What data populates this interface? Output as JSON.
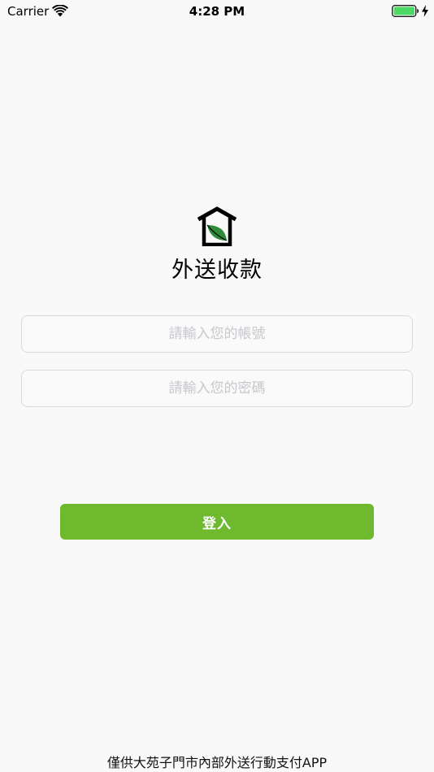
{
  "status_bar": {
    "carrier": "Carrier",
    "time": "4:28 PM",
    "battery_color": "#4cd964"
  },
  "app": {
    "logo_icon": "house-leaf-icon",
    "title": "外送收款",
    "brand_color": "#6eb92d"
  },
  "login_form": {
    "account_placeholder": "請輸入您的帳號",
    "account_value": "",
    "password_placeholder": "請輸入您的密碼",
    "password_value": "",
    "login_label": "登入"
  },
  "footer": {
    "note": "僅供大苑子門市內部外送行動支付APP"
  }
}
